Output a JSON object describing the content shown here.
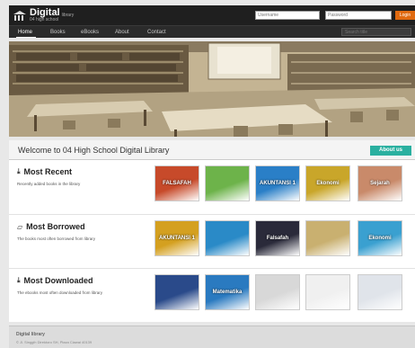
{
  "header": {
    "logo_title": "Digital",
    "logo_sub_top": "library",
    "logo_sub_bottom": "04 high school",
    "username_placeholder": "Username",
    "password_placeholder": "Password",
    "login_label": "Login"
  },
  "nav": {
    "items": [
      "Home",
      "Books",
      "eBooks",
      "About",
      "Contact"
    ],
    "active": "Home",
    "search_placeholder": "Search title"
  },
  "welcome": {
    "title": "Welcome to 04 High School Digital Library",
    "about_button": "About us"
  },
  "sections": [
    {
      "title": "Most Recent",
      "description": "Recently added books in the library",
      "books": [
        {
          "label": "FALSAFAH",
          "color": "#c74a2a"
        },
        {
          "label": "",
          "color": "#6db34a"
        },
        {
          "label": "AKUNTANSI 1",
          "color": "#2a7fc7"
        },
        {
          "label": "Ekonomi",
          "color": "#c9a62a"
        },
        {
          "label": "Sejarah",
          "color": "#c98a6a"
        }
      ]
    },
    {
      "title": "Most Borrowed",
      "description": "The books most often borrowed from library",
      "books": [
        {
          "label": "AKUNTANSI 1",
          "color": "#d4a020"
        },
        {
          "label": "",
          "color": "#2a8ac7"
        },
        {
          "label": "Falsafah",
          "color": "#2a2a3a"
        },
        {
          "label": "",
          "color": "#c9b070"
        },
        {
          "label": "Ekonomi",
          "color": "#3aa0d0"
        }
      ]
    },
    {
      "title": "Most Downloaded",
      "description": "The ebooks most often downloaded from library",
      "books": [
        {
          "label": "",
          "color": "#2a4a8a"
        },
        {
          "label": "Matematika",
          "color": "#2a7ac0"
        },
        {
          "label": "",
          "color": "#d8d8d8"
        },
        {
          "label": "",
          "color": "#f0f0f0"
        },
        {
          "label": "",
          "color": "#e0e4ea"
        }
      ]
    }
  ],
  "footer": {
    "title": "Digital library",
    "address": "© Jl. Singgih Direktoro SH, Plaza Ciawai 40139"
  },
  "colors": {
    "topbar": "#1f1f1f",
    "accent": "#2ab0a0",
    "login": "#e06a10"
  }
}
